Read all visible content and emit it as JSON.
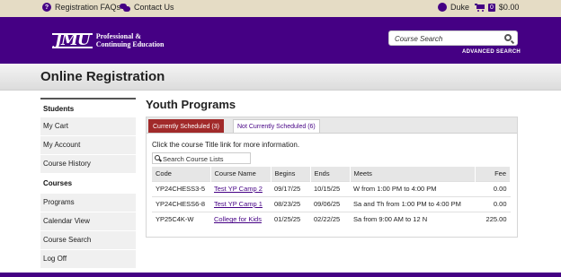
{
  "topbar": {
    "faq_icon": "question-circle-icon",
    "faq_label": "Registration FAQs",
    "contact_icon": "chat-bubbles-icon",
    "contact_label": "Contact Us",
    "user_label": "Duke",
    "cart_count": "0",
    "cart_total": "$0.00"
  },
  "header": {
    "logo_mark": "JMU",
    "logo_line1": "Professional &",
    "logo_line2": "Continuing Education",
    "search_placeholder": "Course Search",
    "advanced_search": "ADVANCED SEARCH"
  },
  "page": {
    "title": "Online Registration"
  },
  "sidebar": {
    "students_heading": "Students",
    "courses_heading": "Courses",
    "student_items": [
      {
        "label": "My Cart"
      },
      {
        "label": "My Account"
      },
      {
        "label": "Course History"
      }
    ],
    "course_items": [
      {
        "label": "Programs"
      },
      {
        "label": "Calendar View"
      },
      {
        "label": "Course Search"
      },
      {
        "label": "Log Off"
      }
    ]
  },
  "main": {
    "heading": "Youth Programs",
    "tabs": [
      {
        "label": "Currently Scheduled (3)"
      },
      {
        "label": "Not Currently Scheduled (6)"
      }
    ],
    "hint": "Click the course Title link for more information.",
    "filter_placeholder": "Search Course Lists",
    "columns": [
      "Code",
      "Course Name",
      "Begins",
      "Ends",
      "Meets",
      "Fee"
    ],
    "rows": [
      {
        "code": "YP24CHESS3-5",
        "name": "Test YP Camp 2",
        "begins": "09/17/25",
        "ends": "10/15/25",
        "meets": "W from 1:00 PM to 4:00 PM",
        "fee": "0.00"
      },
      {
        "code": "YP24CHESS6-8",
        "name": "Test YP Camp 1",
        "begins": "08/23/25",
        "ends": "09/06/25",
        "meets": "Sa and Th from 1:00 PM to 4:00 PM",
        "fee": "0.00"
      },
      {
        "code": "YP25C4K-W",
        "name": "College for Kids",
        "begins": "01/25/25",
        "ends": "02/22/25",
        "meets": "Sa from 9:00 AM to 12 N",
        "fee": "225.00"
      }
    ]
  }
}
